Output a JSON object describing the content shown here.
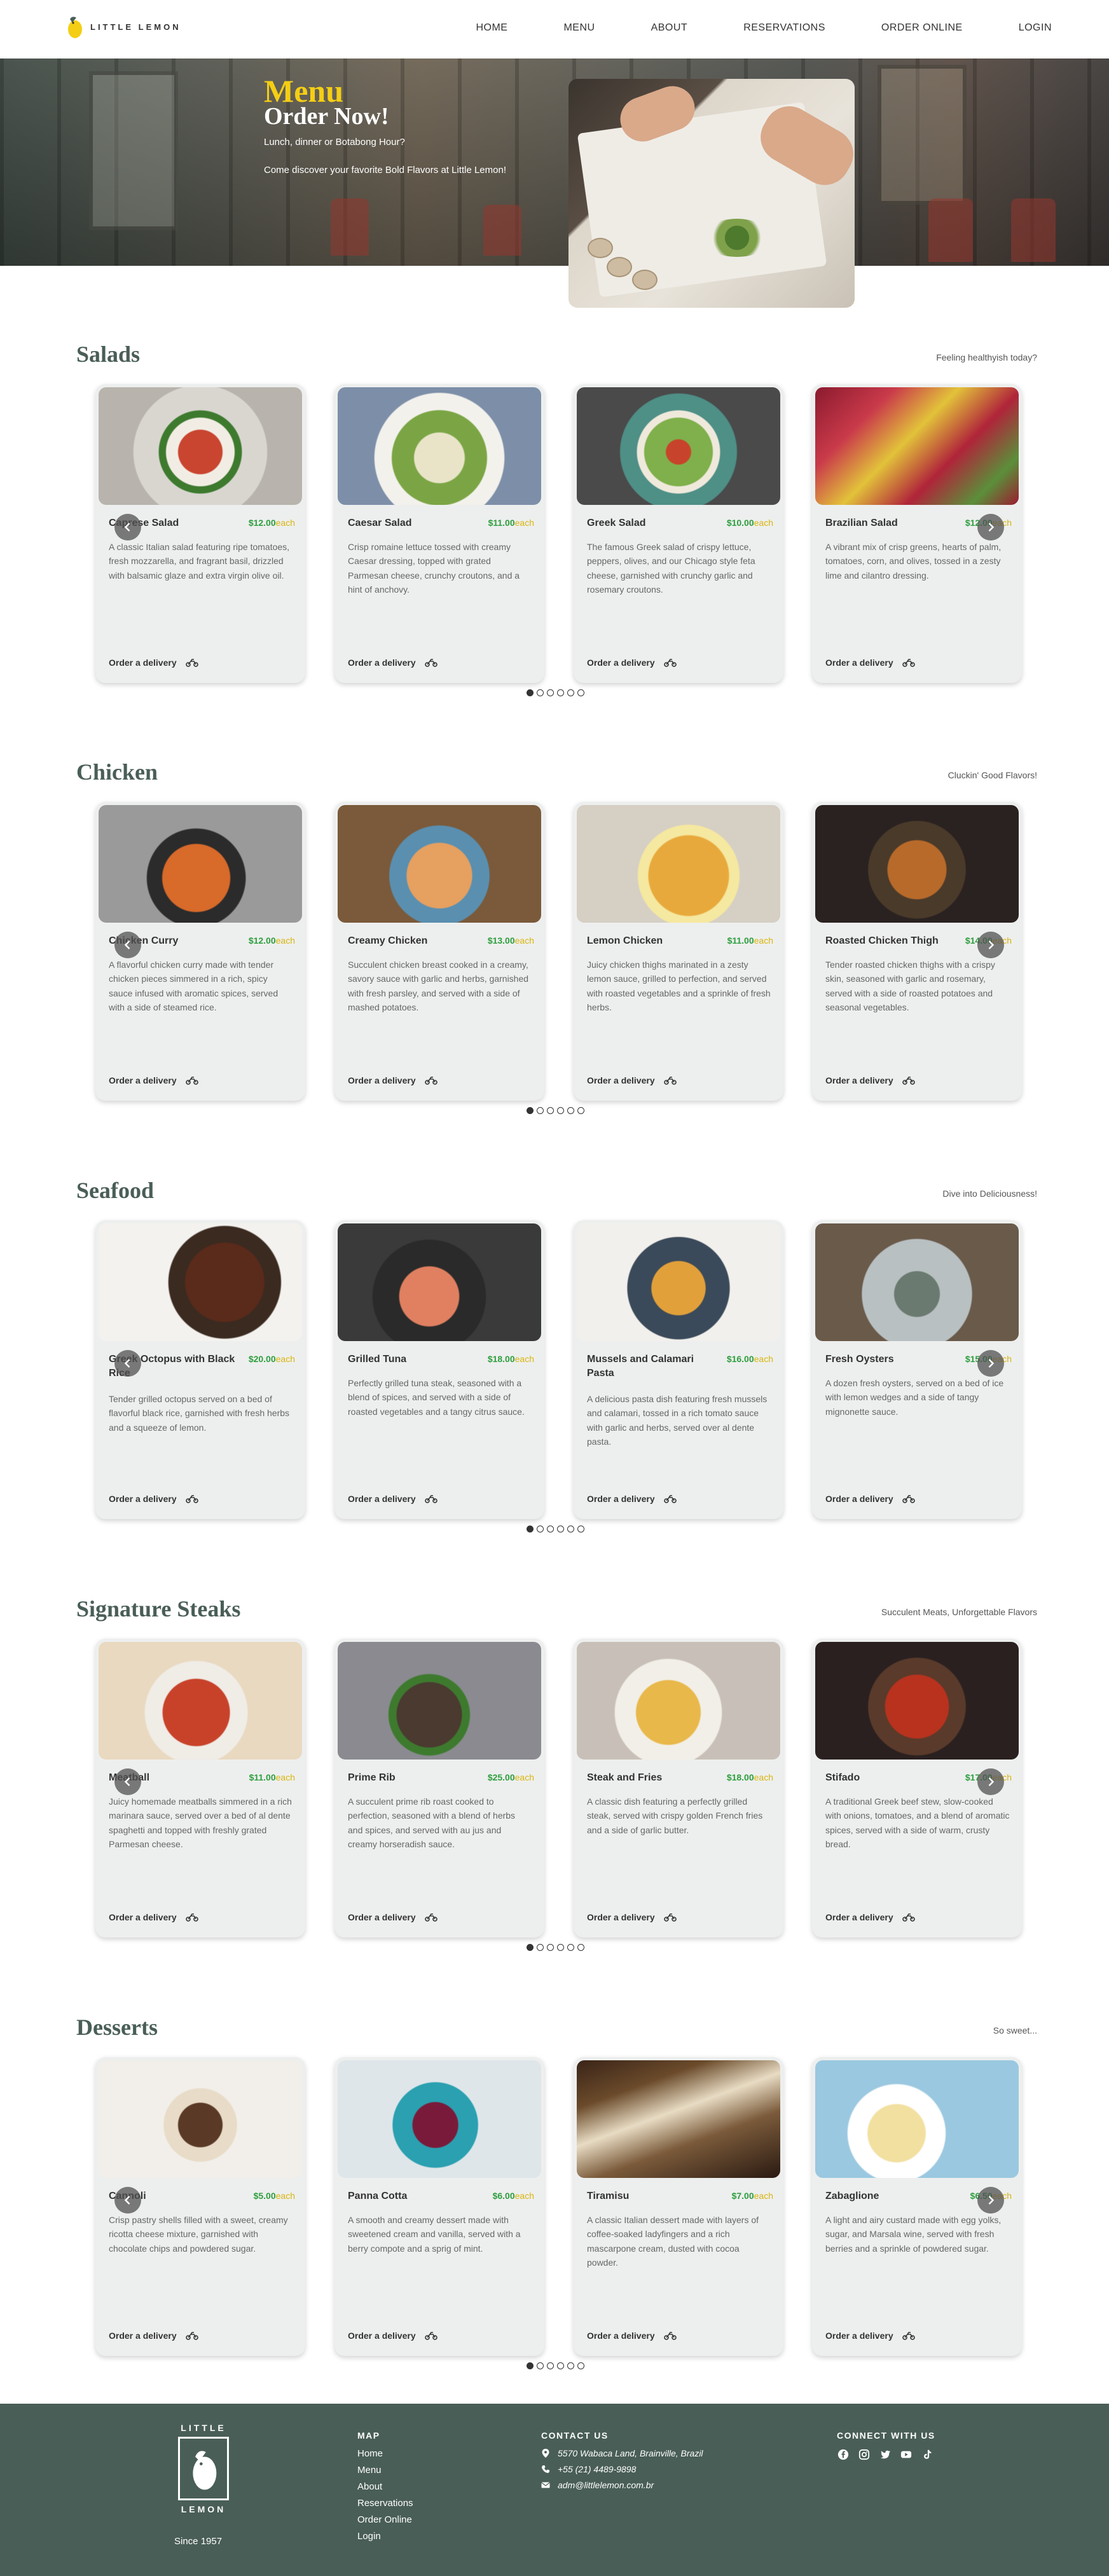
{
  "brand": {
    "name": "LITTLE LEMON"
  },
  "nav": {
    "items": [
      "HOME",
      "MENU",
      "ABOUT",
      "RESERVATIONS",
      "ORDER ONLINE",
      "LOGIN"
    ]
  },
  "hero": {
    "title": "Menu",
    "subtitle": "Order Now!",
    "line1": "Lunch, dinner or Botabong Hour?",
    "line2": "Come discover your favorite Bold Flavors at Little Lemon!"
  },
  "card_common": {
    "order_label": "Order a delivery",
    "each": "each"
  },
  "sections": [
    {
      "title": "Salads",
      "tagline": "Feeling healthyish today?",
      "items": [
        {
          "name": "Caprese Salad",
          "price": "$12.00",
          "desc": "A classic Italian salad featuring ripe tomatoes, fresh mozzarella, and fragrant basil, drizzled with balsamic glaze and extra virgin olive oil."
        },
        {
          "name": "Caesar Salad",
          "price": "$11.00",
          "desc": "Crisp romaine lettuce tossed with creamy Caesar dressing, topped with grated Parmesan cheese, crunchy croutons, and a hint of anchovy."
        },
        {
          "name": "Greek Salad",
          "price": "$10.00",
          "desc": "The famous Greek salad of crispy lettuce, peppers, olives, and our Chicago style feta cheese, garnished with crunchy garlic and rosemary croutons."
        },
        {
          "name": "Brazilian Salad",
          "price": "$12.00",
          "desc": "A vibrant mix of crisp greens, hearts of palm, tomatoes, corn, and olives, tossed in a zesty lime and cilantro dressing."
        }
      ]
    },
    {
      "title": "Chicken",
      "tagline": "Cluckin' Good Flavors!",
      "items": [
        {
          "name": "Chicken Curry",
          "price": "$12.00",
          "desc": "A flavorful chicken curry made with tender chicken pieces simmered in a rich, spicy sauce infused with aromatic spices, served with a side of steamed rice."
        },
        {
          "name": "Creamy Chicken",
          "price": "$13.00",
          "desc": "Succulent chicken breast cooked in a creamy, savory sauce with garlic and herbs, garnished with fresh parsley, and served with a side of mashed potatoes."
        },
        {
          "name": "Lemon Chicken",
          "price": "$11.00",
          "desc": "Juicy chicken thighs marinated in a zesty lemon sauce, grilled to perfection, and served with roasted vegetables and a sprinkle of fresh herbs."
        },
        {
          "name": "Roasted Chicken Thigh",
          "price": "$14.00",
          "desc": "Tender roasted chicken thighs with a crispy skin, seasoned with garlic and rosemary, served with a side of roasted potatoes and seasonal vegetables."
        }
      ]
    },
    {
      "title": "Seafood",
      "tagline": "Dive into Deliciousness!",
      "items": [
        {
          "name": "Greek Octopus with Black Rice",
          "price": "$20.00",
          "desc": "Tender grilled octopus served on a bed of flavorful black rice, garnished with fresh herbs and a squeeze of lemon."
        },
        {
          "name": "Grilled Tuna",
          "price": "$18.00",
          "desc": "Perfectly grilled tuna steak, seasoned with a blend of spices, and served with a side of roasted vegetables and a tangy citrus sauce."
        },
        {
          "name": "Mussels and Calamari Pasta",
          "price": "$16.00",
          "desc": "A delicious pasta dish featuring fresh mussels and calamari, tossed in a rich tomato sauce with garlic and herbs, served over al dente pasta."
        },
        {
          "name": "Fresh Oysters",
          "price": "$15.00",
          "desc": "A dozen fresh oysters, served on a bed of ice with lemon wedges and a side of tangy mignonette sauce."
        }
      ]
    },
    {
      "title": "Signature Steaks",
      "tagline": "Succulent Meats, Unforgettable Flavors",
      "items": [
        {
          "name": "Meatball",
          "price": "$11.00",
          "desc": "Juicy homemade meatballs simmered in a rich marinara sauce, served over a bed of al dente spaghetti and topped with freshly grated Parmesan cheese."
        },
        {
          "name": "Prime Rib",
          "price": "$25.00",
          "desc": "A succulent prime rib roast cooked to perfection, seasoned with a blend of herbs and spices, and served with au jus and creamy horseradish sauce."
        },
        {
          "name": "Steak and Fries",
          "price": "$18.00",
          "desc": "A classic dish featuring a perfectly grilled steak, served with crispy golden French fries and a side of garlic butter."
        },
        {
          "name": "Stifado",
          "price": "$17.00",
          "desc": "A traditional Greek beef stew, slow-cooked with onions, tomatoes, and a blend of aromatic spices, served with a side of warm, crusty bread."
        }
      ]
    },
    {
      "title": "Desserts",
      "tagline": "So sweet...",
      "items": [
        {
          "name": "Cannoli",
          "price": "$5.00",
          "desc": "Crisp pastry shells filled with a sweet, creamy ricotta cheese mixture, garnished with chocolate chips and powdered sugar."
        },
        {
          "name": "Panna Cotta",
          "price": "$6.00",
          "desc": "A smooth and creamy dessert made with sweetened cream and vanilla, served with a berry compote and a sprig of mint."
        },
        {
          "name": "Tiramisu",
          "price": "$7.00",
          "desc": "A classic Italian dessert made with layers of coffee-soaked ladyfingers and a rich mascarpone cream, dusted with cocoa powder."
        },
        {
          "name": "Zabaglione",
          "price": "$6.50",
          "desc": "A light and airy custard made with egg yolks, sugar, and Marsala wine, served with fresh berries and a sprinkle of powdered sugar."
        }
      ]
    }
  ],
  "footer": {
    "logo_top": "LITTLE",
    "logo_bottom": "LEMON",
    "since": "Since 1957",
    "map_title": "MAP",
    "map_links": [
      "Home",
      "Menu",
      "About",
      "Reservations",
      "Order Online",
      "Login"
    ],
    "contact_title": "CONTACT US",
    "address": "5570 Wabaca Land, Brainville, Brazil",
    "phone": "+55 (21) 4489-9898",
    "email": "adm@littlelemon.com.br",
    "social_title": "CONNECT WITH US",
    "social_icons": [
      "facebook-icon",
      "instagram-icon",
      "twitter-icon",
      "youtube-icon",
      "tiktok-icon"
    ]
  },
  "colors": {
    "primary": "#495e57",
    "yellow": "#f4ce14",
    "price_green": "#2e9e3e"
  }
}
